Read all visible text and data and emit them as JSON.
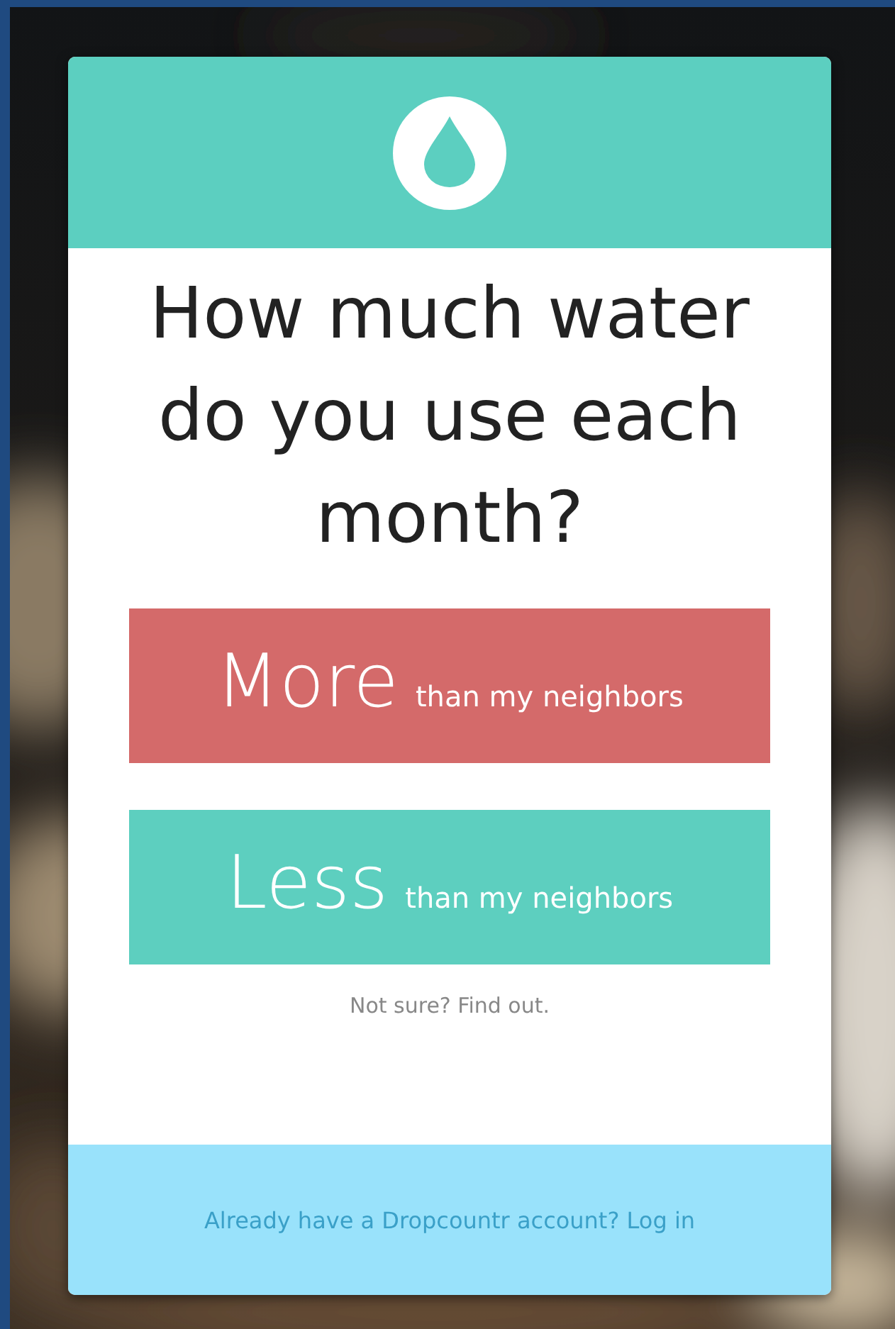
{
  "question": "How much water do you use each month?",
  "choices": [
    {
      "big": "More",
      "small": "than my neighbors",
      "color": "#d46a6a"
    },
    {
      "big": "Less",
      "small": "than my neighbors",
      "color": "#5dcfbf"
    }
  ],
  "help_link": "Not sure? Find out.",
  "footer": {
    "login_link": "Already have a Dropcountr account? Log in"
  }
}
